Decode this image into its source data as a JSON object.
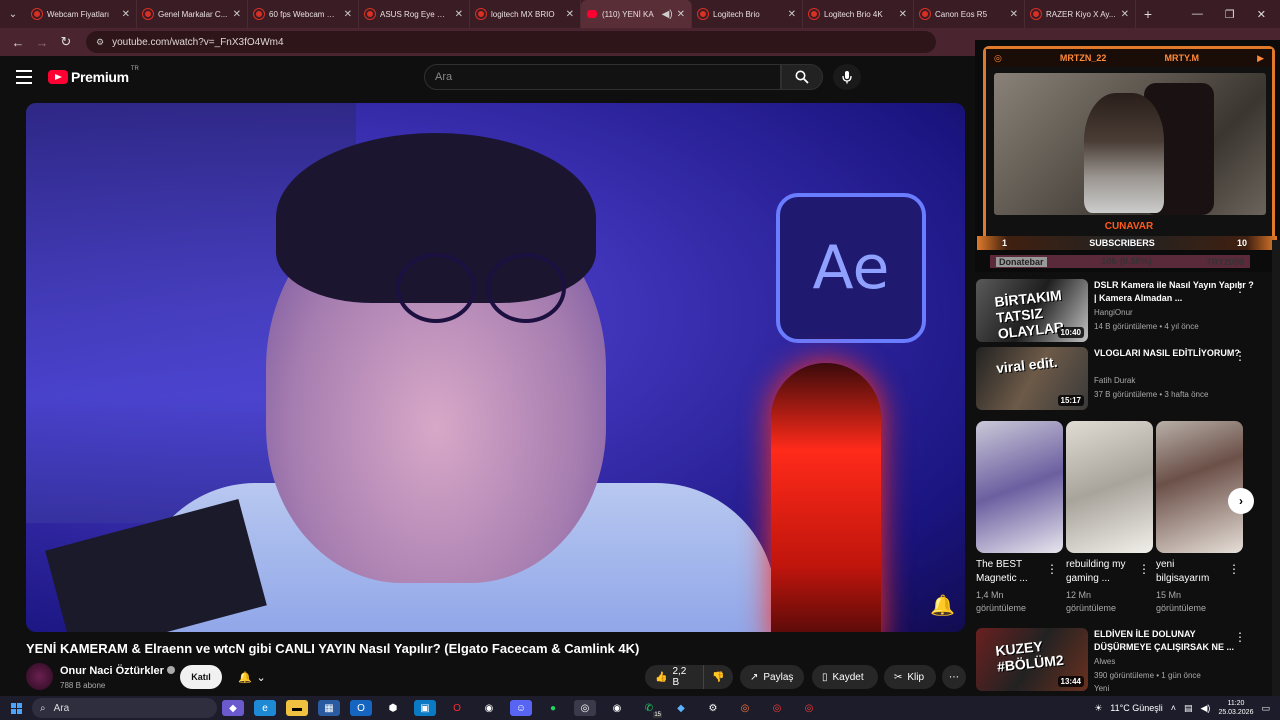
{
  "browser": {
    "tabs": [
      {
        "label": "Webcam Fiyatları",
        "icon": "youtube-icon"
      },
      {
        "label": "Genel Markalar C...",
        "icon": "youtube-icon"
      },
      {
        "label": "60 fps Webcam M...",
        "icon": "youtube-icon"
      },
      {
        "label": "ASUS Rog Eye Us...",
        "icon": "youtube-icon"
      },
      {
        "label": "logitech MX BRIO",
        "icon": "youtube-icon"
      },
      {
        "label": "(110) YENİ KA",
        "icon": "youtube-icon",
        "active": true
      },
      {
        "label": "Logitech Brio",
        "icon": "youtube-icon"
      },
      {
        "label": "Logitech Brio 4K",
        "icon": "youtube-icon"
      },
      {
        "label": "Canon Eos R5",
        "icon": "youtube-icon"
      },
      {
        "label": "RAZER Kiyo X Ay...",
        "icon": "youtube-icon"
      }
    ],
    "url": "youtube.com/watch?v=_FnX3fO4Wm4"
  },
  "youtube": {
    "logo_text": "Premium",
    "logo_region": "TR",
    "search_placeholder": "Ara"
  },
  "video": {
    "title": "YENİ KAMERAM & Elraenn ve wtcN gibi CANLI YAYIN Nasıl Yapılır? (Elgato Facecam & Camlink 4K)",
    "thumbnail_text": "Ae",
    "channel": "Onur Naci Öztürkler",
    "subscribers": "788 B abone",
    "join_label": "Katıl",
    "likes": "2,2 B",
    "share_label": "Paylaş",
    "save_label": "Kaydet",
    "clip_label": "Klip"
  },
  "overlay": {
    "top_left": "MRTZN_22",
    "top_right": "MRTY.M",
    "name": "CUNAVAR",
    "subs_left": "1",
    "subs_label": "SUBSCRIBERS",
    "subs_right": "10",
    "donate_label": "Donatebar",
    "donate_mid": "10₺ (0.50%)",
    "donate_goal": "TRY2000"
  },
  "recommendations": [
    {
      "title": "DSLR Kamera ile Nasıl Yayın Yapılır ? | Kamera Almadan ...",
      "channel": "HangiOnur",
      "meta": "14 B görüntüleme • 4 yıl önce",
      "duration": "10:40",
      "thumb_text": "BİRTAKIM TATSIZ OLAYLAR"
    },
    {
      "title": "VLOGLARI NASIL EDİTLİYORUM?",
      "channel": "Fatih Durak",
      "meta": "37 B görüntüleme • 3 hafta önce",
      "duration": "15:17",
      "thumb_text": "viral edit."
    },
    {
      "title": "ELDİVEN İLE DOLUNAY DÜŞÜRMEYE ÇALIŞIRSAK NE ...",
      "channel": "Alwes",
      "meta": "390 görüntüleme • 1 gün önce",
      "badge": "Yeni",
      "duration": "13:44",
      "thumb_text": "KUZEY #BÖLÜM2"
    }
  ],
  "shorts": [
    {
      "title": "The BEST Magnetic ...",
      "views": "1,4 Mn görüntüleme"
    },
    {
      "title": "rebuilding my gaming ...",
      "views": "12 Mn görüntüleme"
    },
    {
      "title": "yeni bilgisayarım",
      "views": "15 Mn görüntüleme"
    }
  ],
  "taskbar": {
    "search_label": "Ara",
    "weather": "11°C  Güneşli",
    "time": "11:20",
    "date": "25.03.2026",
    "whatsapp_badge": "15"
  }
}
